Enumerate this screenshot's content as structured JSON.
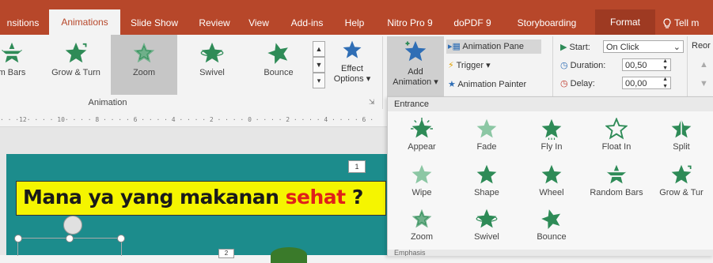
{
  "tabs": [
    {
      "label": "nsitions"
    },
    {
      "label": "Animations"
    },
    {
      "label": "Slide Show"
    },
    {
      "label": "Review"
    },
    {
      "label": "View"
    },
    {
      "label": "Add-ins"
    },
    {
      "label": "Help"
    },
    {
      "label": "Nitro Pro 9"
    },
    {
      "label": "doPDF 9"
    },
    {
      "label": "Storyboarding"
    },
    {
      "label": "Format"
    },
    {
      "label": "Tell m"
    }
  ],
  "animation_gallery": {
    "items": [
      {
        "label": "m Bars",
        "icon": "random-bars-star-icon"
      },
      {
        "label": "Grow & Turn",
        "icon": "grow-turn-star-icon"
      },
      {
        "label": "Zoom",
        "icon": "zoom-star-icon"
      },
      {
        "label": "Swivel",
        "icon": "swivel-star-icon"
      },
      {
        "label": "Bounce",
        "icon": "bounce-star-icon"
      }
    ],
    "effect_options_line1": "Effect",
    "effect_options_line2": "Options",
    "group_label": "Animation"
  },
  "advanced": {
    "add_animation_line1": "Add",
    "add_animation_line2": "Animation",
    "animation_pane": "Animation Pane",
    "trigger": "Trigger",
    "animation_painter": "Animation Painter"
  },
  "timing": {
    "start_label": "Start:",
    "start_value": "On Click",
    "duration_label": "Duration:",
    "duration_value": "00,50",
    "delay_label": "Delay:",
    "delay_value": "00,00",
    "reorder_label": "Reor"
  },
  "ruler_text": "· · ·12· · · · 10· · · · 8 · · · · 6 · · · · 4 · · · · 2 · · · · 0 · · · · 2 · · · · 4 · · · · 6 ·",
  "slide": {
    "title_part1": "Mana ya yang makanan ",
    "title_part2": "sehat",
    "title_part3": " ?",
    "badge_top": "1",
    "badge_bottom": "2",
    "highlight_color": "#f5f500",
    "teal_color": "#1c8c8c"
  },
  "entrance_panel": {
    "heading": "Entrance",
    "items": [
      {
        "label": "Appear",
        "icon": "appear-star-icon"
      },
      {
        "label": "Fade",
        "icon": "fade-star-icon"
      },
      {
        "label": "Fly In",
        "icon": "fly-in-star-icon"
      },
      {
        "label": "Float In",
        "icon": "float-in-star-icon"
      },
      {
        "label": "Split",
        "icon": "split-star-icon"
      },
      {
        "label": "Wipe",
        "icon": "wipe-star-icon"
      },
      {
        "label": "Shape",
        "icon": "shape-star-icon"
      },
      {
        "label": "Wheel",
        "icon": "wheel-star-icon"
      },
      {
        "label": "Random Bars",
        "icon": "random-bars-star-icon"
      },
      {
        "label": "Grow & Tur",
        "icon": "grow-turn-star-icon"
      },
      {
        "label": "Zoom",
        "icon": "zoom-star-icon"
      },
      {
        "label": "Swivel",
        "icon": "swivel-star-icon"
      },
      {
        "label": "Bounce",
        "icon": "bounce-star-icon"
      }
    ],
    "next_heading": "Emphasis"
  },
  "colors": {
    "ribbon_red": "#b7472a",
    "star_green": "#2e8b57",
    "star_blue": "#2f6eb5"
  }
}
